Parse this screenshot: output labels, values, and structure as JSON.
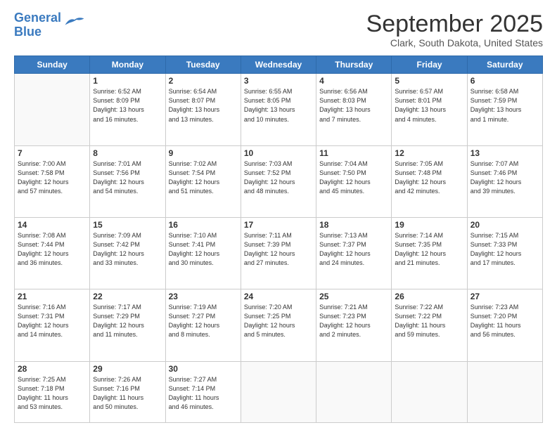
{
  "logo": {
    "line1": "General",
    "line2": "Blue"
  },
  "title": "September 2025",
  "subtitle": "Clark, South Dakota, United States",
  "days_of_week": [
    "Sunday",
    "Monday",
    "Tuesday",
    "Wednesday",
    "Thursday",
    "Friday",
    "Saturday"
  ],
  "weeks": [
    [
      {
        "day": "",
        "info": ""
      },
      {
        "day": "1",
        "info": "Sunrise: 6:52 AM\nSunset: 8:09 PM\nDaylight: 13 hours\nand 16 minutes."
      },
      {
        "day": "2",
        "info": "Sunrise: 6:54 AM\nSunset: 8:07 PM\nDaylight: 13 hours\nand 13 minutes."
      },
      {
        "day": "3",
        "info": "Sunrise: 6:55 AM\nSunset: 8:05 PM\nDaylight: 13 hours\nand 10 minutes."
      },
      {
        "day": "4",
        "info": "Sunrise: 6:56 AM\nSunset: 8:03 PM\nDaylight: 13 hours\nand 7 minutes."
      },
      {
        "day": "5",
        "info": "Sunrise: 6:57 AM\nSunset: 8:01 PM\nDaylight: 13 hours\nand 4 minutes."
      },
      {
        "day": "6",
        "info": "Sunrise: 6:58 AM\nSunset: 7:59 PM\nDaylight: 13 hours\nand 1 minute."
      }
    ],
    [
      {
        "day": "7",
        "info": "Sunrise: 7:00 AM\nSunset: 7:58 PM\nDaylight: 12 hours\nand 57 minutes."
      },
      {
        "day": "8",
        "info": "Sunrise: 7:01 AM\nSunset: 7:56 PM\nDaylight: 12 hours\nand 54 minutes."
      },
      {
        "day": "9",
        "info": "Sunrise: 7:02 AM\nSunset: 7:54 PM\nDaylight: 12 hours\nand 51 minutes."
      },
      {
        "day": "10",
        "info": "Sunrise: 7:03 AM\nSunset: 7:52 PM\nDaylight: 12 hours\nand 48 minutes."
      },
      {
        "day": "11",
        "info": "Sunrise: 7:04 AM\nSunset: 7:50 PM\nDaylight: 12 hours\nand 45 minutes."
      },
      {
        "day": "12",
        "info": "Sunrise: 7:05 AM\nSunset: 7:48 PM\nDaylight: 12 hours\nand 42 minutes."
      },
      {
        "day": "13",
        "info": "Sunrise: 7:07 AM\nSunset: 7:46 PM\nDaylight: 12 hours\nand 39 minutes."
      }
    ],
    [
      {
        "day": "14",
        "info": "Sunrise: 7:08 AM\nSunset: 7:44 PM\nDaylight: 12 hours\nand 36 minutes."
      },
      {
        "day": "15",
        "info": "Sunrise: 7:09 AM\nSunset: 7:42 PM\nDaylight: 12 hours\nand 33 minutes."
      },
      {
        "day": "16",
        "info": "Sunrise: 7:10 AM\nSunset: 7:41 PM\nDaylight: 12 hours\nand 30 minutes."
      },
      {
        "day": "17",
        "info": "Sunrise: 7:11 AM\nSunset: 7:39 PM\nDaylight: 12 hours\nand 27 minutes."
      },
      {
        "day": "18",
        "info": "Sunrise: 7:13 AM\nSunset: 7:37 PM\nDaylight: 12 hours\nand 24 minutes."
      },
      {
        "day": "19",
        "info": "Sunrise: 7:14 AM\nSunset: 7:35 PM\nDaylight: 12 hours\nand 21 minutes."
      },
      {
        "day": "20",
        "info": "Sunrise: 7:15 AM\nSunset: 7:33 PM\nDaylight: 12 hours\nand 17 minutes."
      }
    ],
    [
      {
        "day": "21",
        "info": "Sunrise: 7:16 AM\nSunset: 7:31 PM\nDaylight: 12 hours\nand 14 minutes."
      },
      {
        "day": "22",
        "info": "Sunrise: 7:17 AM\nSunset: 7:29 PM\nDaylight: 12 hours\nand 11 minutes."
      },
      {
        "day": "23",
        "info": "Sunrise: 7:19 AM\nSunset: 7:27 PM\nDaylight: 12 hours\nand 8 minutes."
      },
      {
        "day": "24",
        "info": "Sunrise: 7:20 AM\nSunset: 7:25 PM\nDaylight: 12 hours\nand 5 minutes."
      },
      {
        "day": "25",
        "info": "Sunrise: 7:21 AM\nSunset: 7:23 PM\nDaylight: 12 hours\nand 2 minutes."
      },
      {
        "day": "26",
        "info": "Sunrise: 7:22 AM\nSunset: 7:22 PM\nDaylight: 11 hours\nand 59 minutes."
      },
      {
        "day": "27",
        "info": "Sunrise: 7:23 AM\nSunset: 7:20 PM\nDaylight: 11 hours\nand 56 minutes."
      }
    ],
    [
      {
        "day": "28",
        "info": "Sunrise: 7:25 AM\nSunset: 7:18 PM\nDaylight: 11 hours\nand 53 minutes."
      },
      {
        "day": "29",
        "info": "Sunrise: 7:26 AM\nSunset: 7:16 PM\nDaylight: 11 hours\nand 50 minutes."
      },
      {
        "day": "30",
        "info": "Sunrise: 7:27 AM\nSunset: 7:14 PM\nDaylight: 11 hours\nand 46 minutes."
      },
      {
        "day": "",
        "info": ""
      },
      {
        "day": "",
        "info": ""
      },
      {
        "day": "",
        "info": ""
      },
      {
        "day": "",
        "info": ""
      }
    ]
  ]
}
